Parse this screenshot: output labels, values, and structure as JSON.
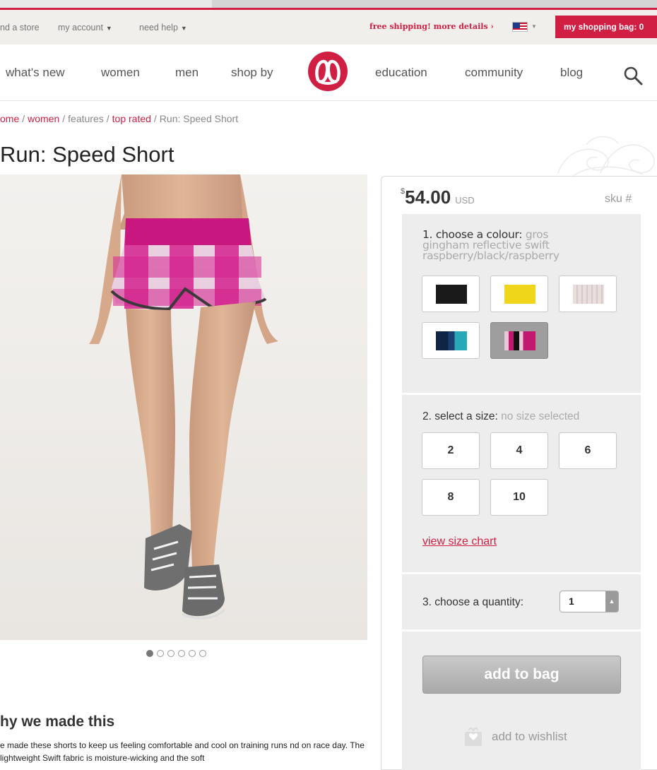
{
  "utility_bar": {
    "find_store": "nd a store",
    "my_account": "my account",
    "need_help": "need help",
    "free_shipping": "free shipping! more details",
    "shopping_bag": "my shopping bag: 0"
  },
  "nav": {
    "items": [
      "what's new",
      "women",
      "men",
      "shop by",
      "education",
      "community",
      "blog"
    ]
  },
  "breadcrumb": {
    "home": "ome",
    "women": "women",
    "features": "features",
    "top_rated": "top rated",
    "current": "Run: Speed Short",
    "separator": "/"
  },
  "product": {
    "title": "Run: Speed Short",
    "price_symbol": "$",
    "price": "54.00",
    "currency": "USD",
    "sku_label": "sku #"
  },
  "colour": {
    "label": "1. choose a colour:",
    "selected": "gros gingham reflective swift raspberry/black/raspberry",
    "swatches": [
      {
        "name": "black",
        "color": "#1a1a1a"
      },
      {
        "name": "yellow",
        "color": "#f0d61a"
      },
      {
        "name": "light stripe",
        "color": "#e6dcdc"
      },
      {
        "name": "navy teal",
        "color": "#1c3557"
      },
      {
        "name": "raspberry black",
        "color": "#c2186d"
      }
    ]
  },
  "size": {
    "label": "2. select a size:",
    "status": "no size selected",
    "options": [
      "2",
      "4",
      "6",
      "8",
      "10"
    ],
    "chart_link": "view size chart"
  },
  "quantity": {
    "label": "3. choose a quantity:",
    "value": "1"
  },
  "actions": {
    "add_to_bag": "add to bag",
    "add_to_wishlist": "add to wishlist"
  },
  "gallery": {
    "dot_count": 6,
    "active_index": 0
  },
  "description": {
    "heading": "hy we made this",
    "text": "e made these shorts to keep us feeling comfortable and cool on training runs nd on race day. The lightweight Swift fabric is moisture-wicking and the soft"
  },
  "colors": {
    "brand": "#d11f44"
  }
}
